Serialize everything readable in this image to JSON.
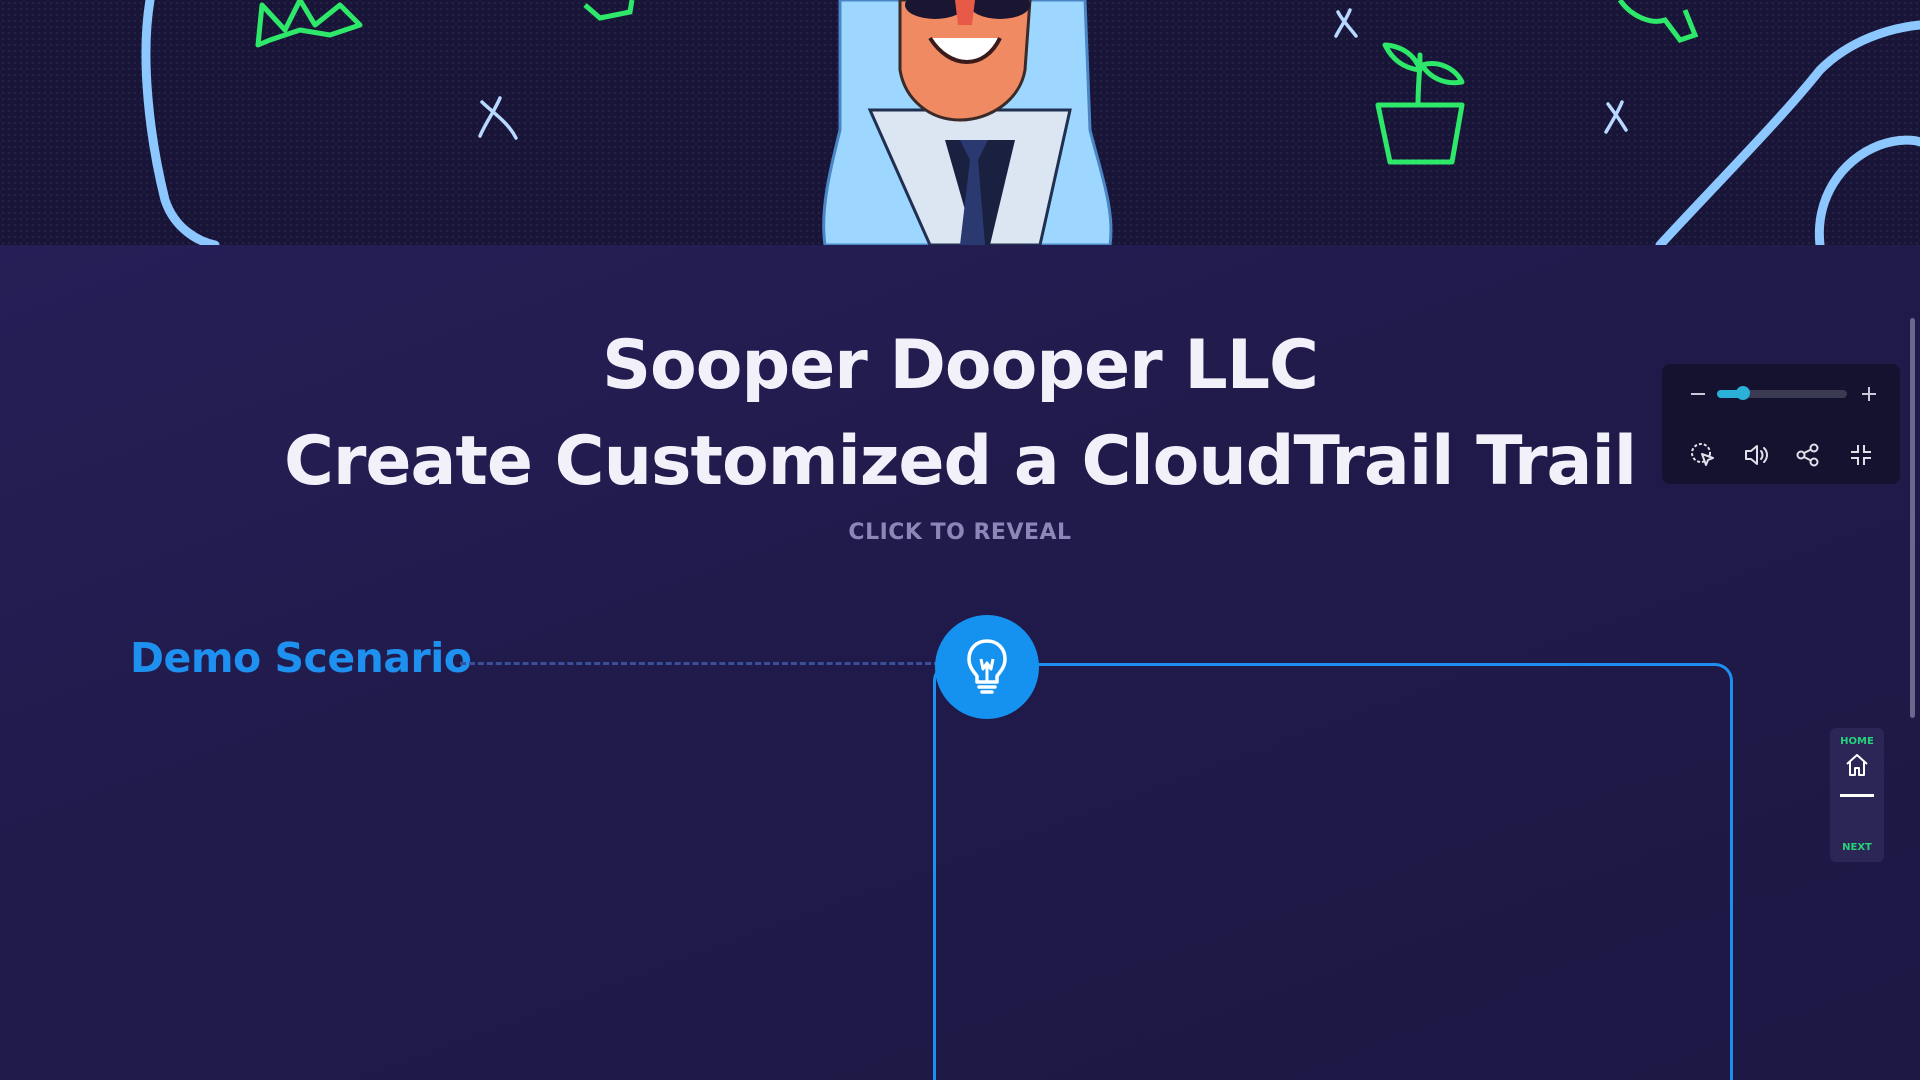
{
  "presentation": {
    "company": "Sooper Dooper LLC",
    "title": "Create Customized a CloudTrail Trail",
    "reveal_prompt": "CLICK TO REVEAL"
  },
  "scenario": {
    "label": "Demo Scenario",
    "icon": "lightbulb-icon"
  },
  "controls": {
    "zoom_level": 0.2,
    "icons": [
      "zoom-out-icon",
      "zoom-in-icon",
      "cursor-select-icon",
      "volume-icon",
      "share-icon",
      "exit-fullscreen-icon"
    ]
  },
  "nav": {
    "home_label": "HOME",
    "next_label": "NEXT"
  },
  "colors": {
    "accent_blue": "#1e90f0",
    "background": "#201b4a",
    "nav_green": "#27d37a",
    "zoom_teal": "#2bb0d8"
  }
}
